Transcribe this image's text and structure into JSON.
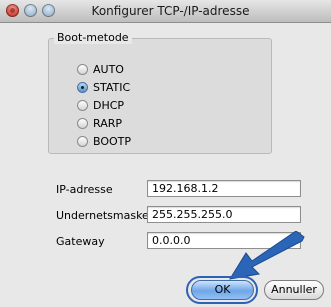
{
  "window": {
    "title": "Konfigurer TCP-/IP-adresse"
  },
  "boot_method": {
    "label": "Boot-metode",
    "options": [
      {
        "label": "AUTO",
        "selected": false
      },
      {
        "label": "STATIC",
        "selected": true
      },
      {
        "label": "DHCP",
        "selected": false
      },
      {
        "label": "RARP",
        "selected": false
      },
      {
        "label": "BOOTP",
        "selected": false
      }
    ]
  },
  "fields": {
    "ip": {
      "label": "IP-adresse",
      "value": "192.168.1.2"
    },
    "subnet": {
      "label": "Undernetsmaske",
      "value": "255.255.255.0"
    },
    "gateway": {
      "label": "Gateway",
      "value": "0.0.0.0"
    }
  },
  "buttons": {
    "ok": "OK",
    "cancel": "Annuller"
  },
  "colors": {
    "highlight_arrow": "#2a65b7",
    "ok_button": "#6fa6e6"
  }
}
